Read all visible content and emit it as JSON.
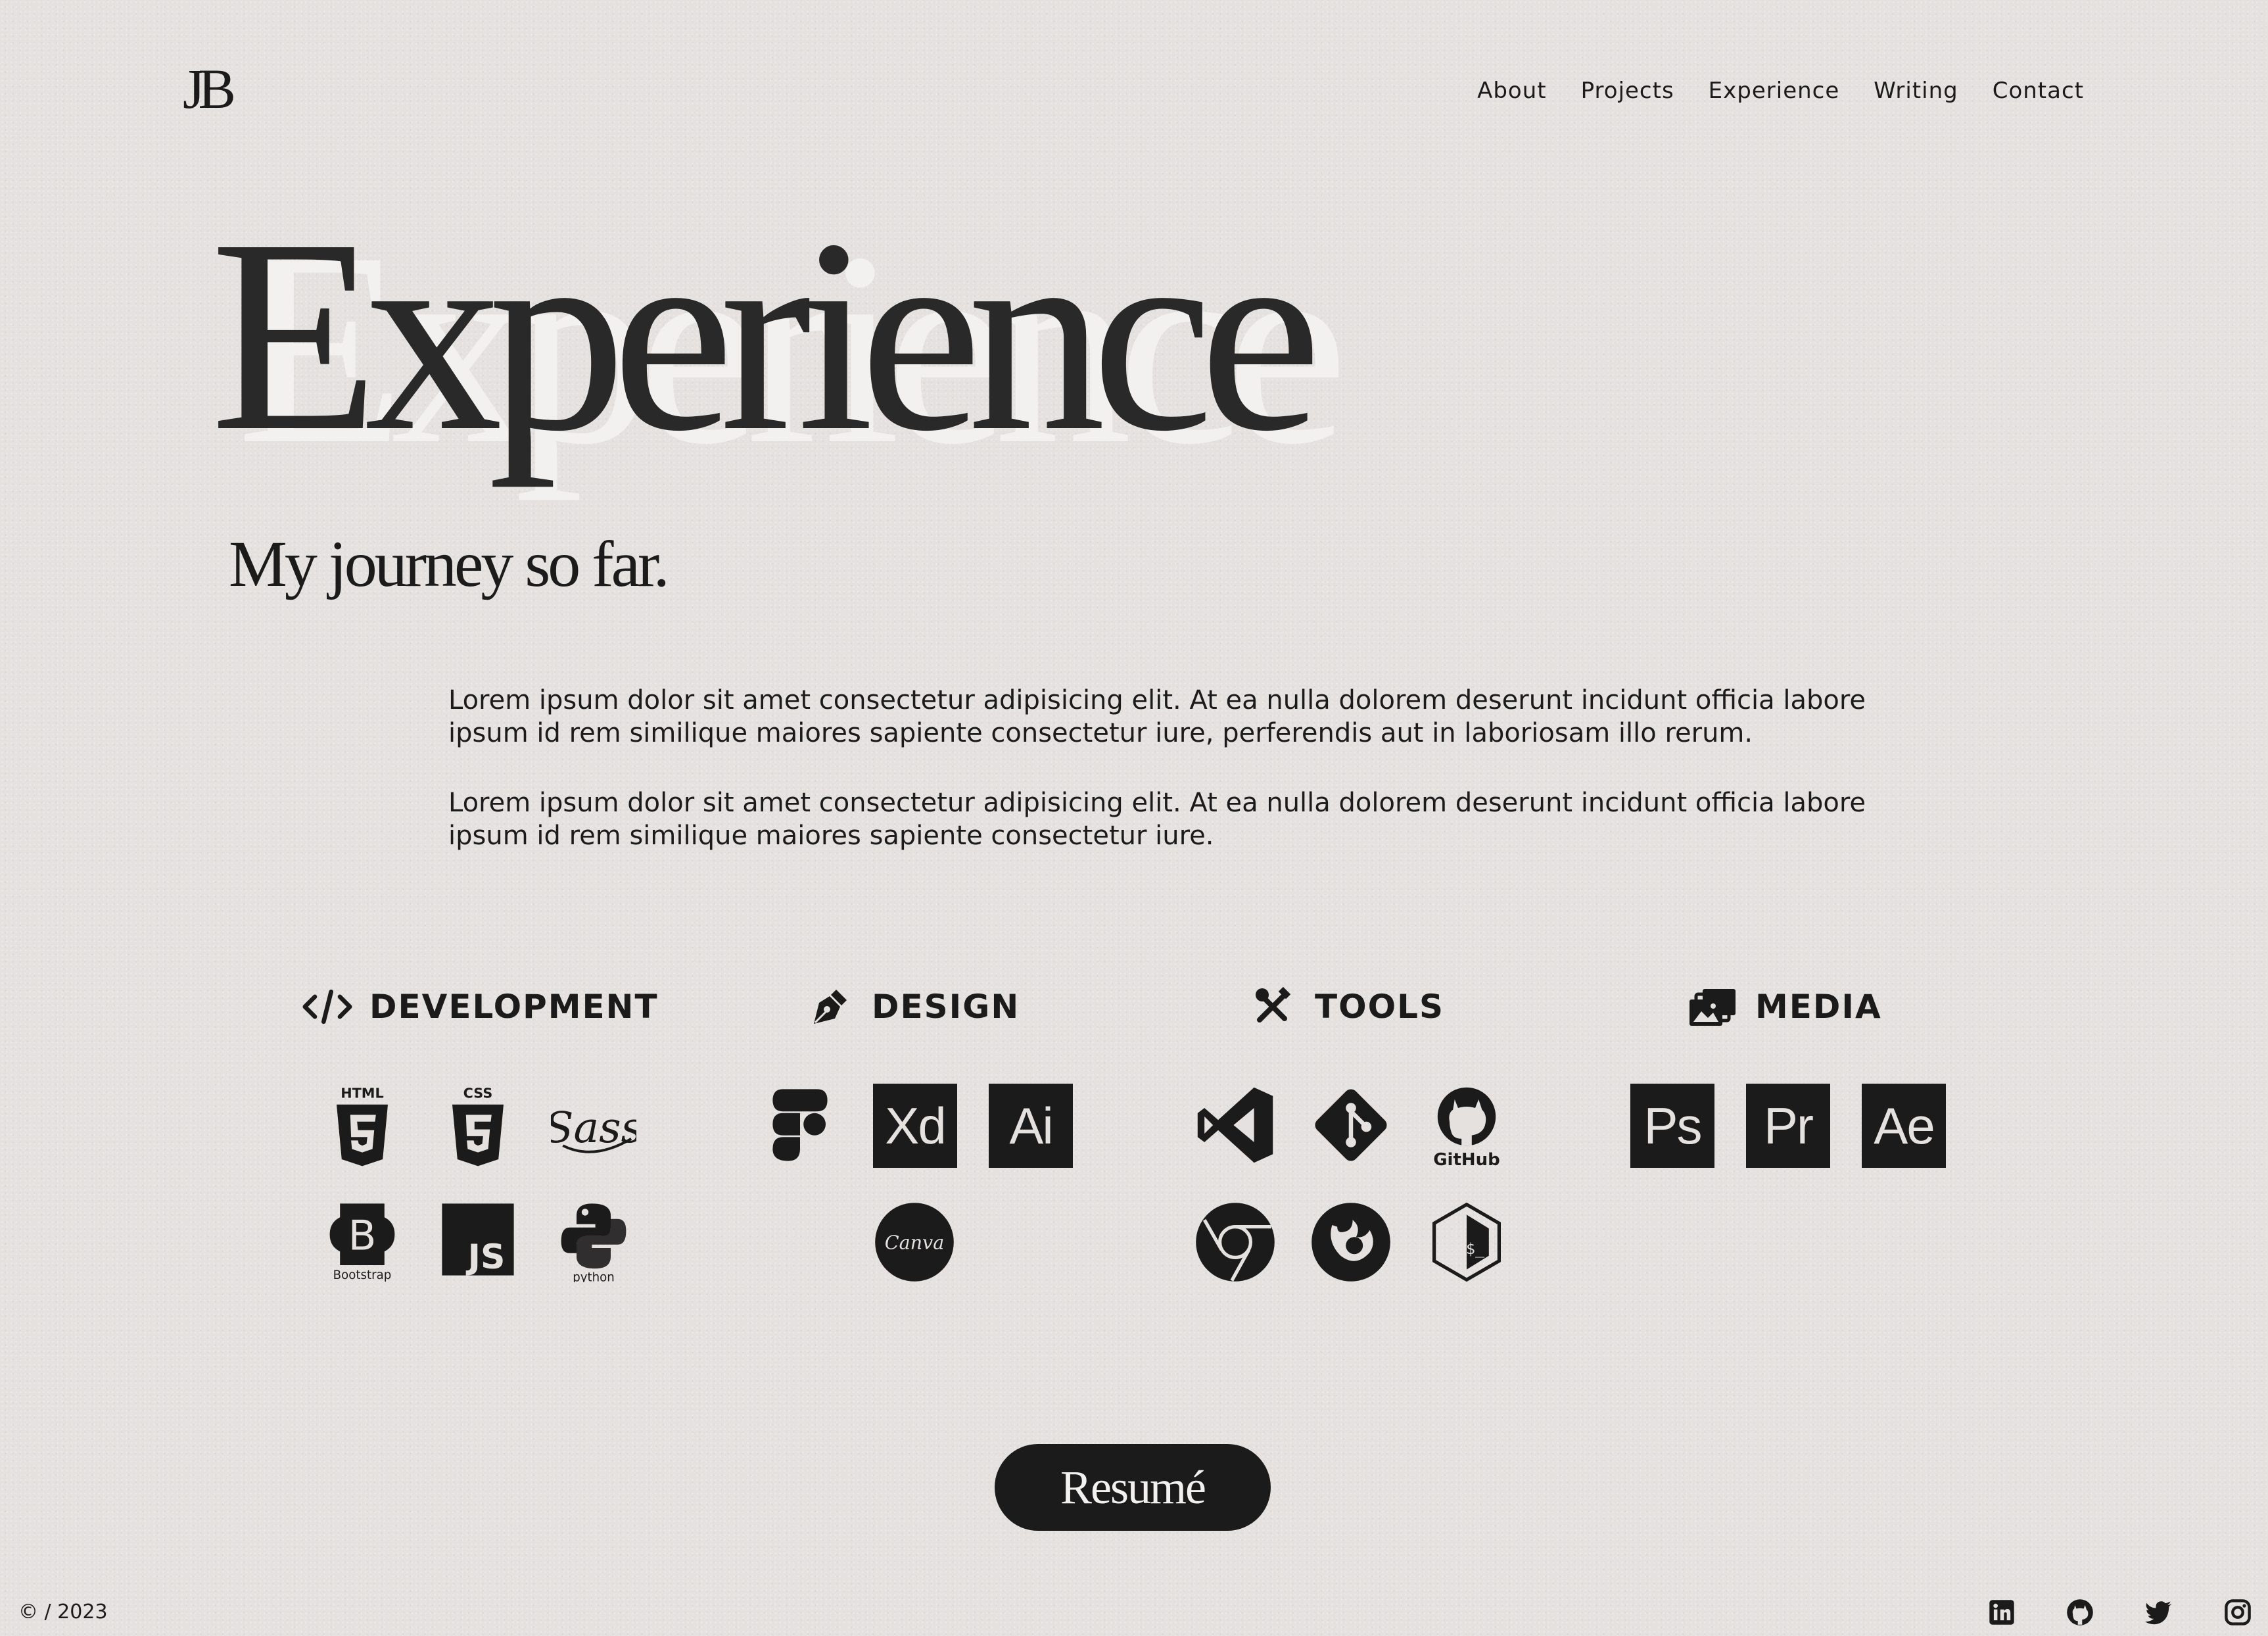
{
  "header": {
    "logo": "JB",
    "nav": [
      "About",
      "Projects",
      "Experience",
      "Writing",
      "Contact"
    ]
  },
  "hero": {
    "title": "Experience",
    "subtitle": "My journey so far."
  },
  "intro": {
    "paragraphs": [
      "Lorem ipsum dolor sit amet consectetur adipisicing elit. At ea nulla dolorem deserunt incidunt officia labore ipsum id rem similique maiores sapiente consectetur iure, perferendis aut in laboriosam illo rerum.",
      "Lorem ipsum dolor sit amet consectetur adipisicing elit. At ea nulla dolorem deserunt incidunt officia labore ipsum id rem similique maiores sapiente consectetur iure."
    ]
  },
  "skills": {
    "development": {
      "title": "DEVELOPMENT",
      "icon": "code-icon",
      "items": [
        {
          "icon": "html5-icon",
          "label": "HTML"
        },
        {
          "icon": "css3-icon",
          "label": "CSS"
        },
        {
          "icon": "sass-icon",
          "label": "Sass"
        },
        {
          "icon": "bootstrap-icon",
          "label": "Bootstrap"
        },
        {
          "icon": "javascript-icon",
          "label": "JS"
        },
        {
          "icon": "python-icon",
          "label": "python"
        }
      ]
    },
    "design": {
      "title": "DESIGN",
      "icon": "pen-nib-icon",
      "items": [
        {
          "icon": "figma-icon"
        },
        {
          "icon": "adobe-xd-icon",
          "label": "Xd"
        },
        {
          "icon": "adobe-illustrator-icon",
          "label": "Ai"
        },
        {
          "icon": "canva-icon",
          "label": "Canva"
        }
      ]
    },
    "tools": {
      "title": "TOOLS",
      "icon": "tools-icon",
      "items": [
        {
          "icon": "vscode-icon"
        },
        {
          "icon": "git-icon"
        },
        {
          "icon": "github-icon",
          "label": "GitHub"
        },
        {
          "icon": "chrome-icon"
        },
        {
          "icon": "firefox-icon"
        },
        {
          "icon": "terminal-icon",
          "label": "$_"
        }
      ]
    },
    "media": {
      "title": "MEDIA",
      "icon": "photo-album-icon",
      "items": [
        {
          "icon": "photoshop-icon",
          "label": "Ps"
        },
        {
          "icon": "premiere-pro-icon",
          "label": "Pr"
        },
        {
          "icon": "after-effects-icon",
          "label": "Ae"
        }
      ]
    }
  },
  "resume_button": "Resumé",
  "footer": {
    "copyright": "© / 2023",
    "social": [
      "linkedin-icon",
      "github-icon",
      "twitter-icon",
      "instagram-icon"
    ]
  },
  "colors": {
    "background": "#e4e1df",
    "ink": "#1c1b1b",
    "hero_shadow": "#f3f1f0"
  }
}
